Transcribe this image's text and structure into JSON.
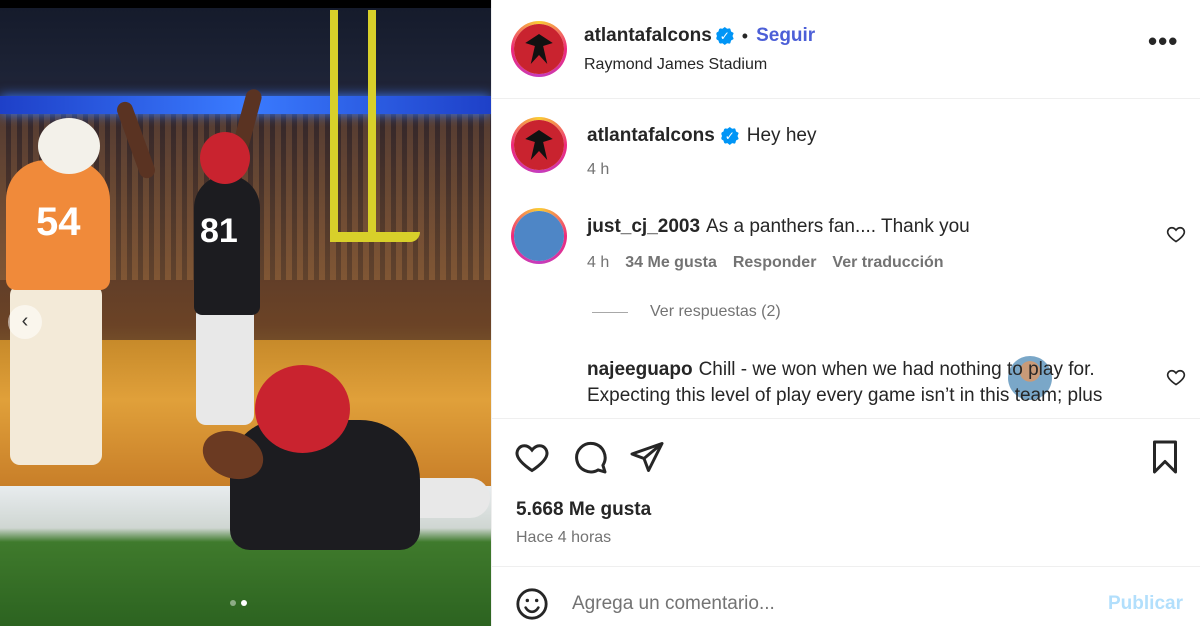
{
  "post": {
    "username": "atlantafalcons",
    "follow_label": "Seguir",
    "separator": "•",
    "location": "Raymond James Stadium",
    "more_icon": "more-horizontal-icon"
  },
  "photo": {
    "jersey_left": "54",
    "jersey_center": "81",
    "carousel_total": 2,
    "carousel_active": 2
  },
  "caption": {
    "username": "atlantafalcons",
    "text": "Hey hey",
    "time": "4 h"
  },
  "comments": [
    {
      "username": "just_cj_2003",
      "text": "As a panthers fan.... Thank you",
      "time": "4 h",
      "likes": "34 Me gusta",
      "reply": "Responder",
      "translate": "Ver traducción"
    },
    {
      "username": "najeeguapo",
      "text": "Chill - we won when we had nothing to play for. Expecting this level of play every game isn’t in this team; plus"
    }
  ],
  "view_replies": "Ver respuestas (2)",
  "likes_count": "5.668 Me gusta",
  "posted_time": "Hace 4 horas",
  "add_comment": {
    "placeholder": "Agrega un comentario...",
    "post_label": "Publicar"
  },
  "colors": {
    "verified": "#0095f6",
    "follow": "#4c5fd7",
    "post_disabled": "#b2dffc",
    "falcons_red": "#c9232f"
  }
}
